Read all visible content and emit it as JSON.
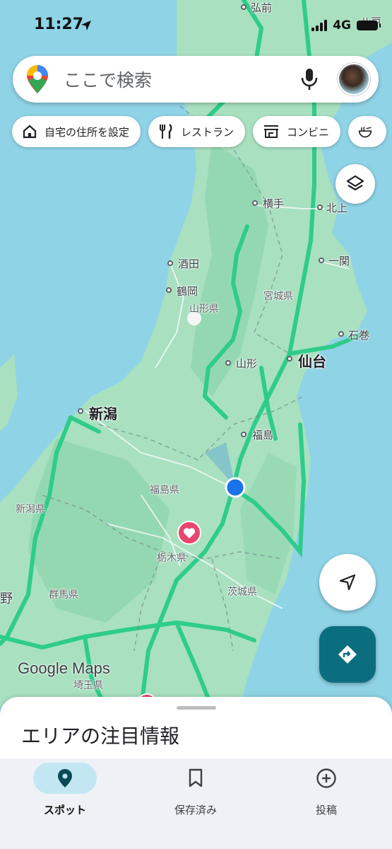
{
  "status_bar": {
    "time": "11:27",
    "network": "4G"
  },
  "search": {
    "placeholder": "ここで検索"
  },
  "chips": [
    {
      "label": "自宅の住所を設定",
      "icon": "home-icon"
    },
    {
      "label": "レストラン",
      "icon": "restaurant-icon"
    },
    {
      "label": "コンビニ",
      "icon": "store-icon"
    }
  ],
  "map": {
    "brand": "Google Maps",
    "cities": {
      "hirosaki": "弘前",
      "hachinohe": "八戸",
      "yokote": "横手",
      "kitakami": "北上",
      "ichinoseki": "一関",
      "sakata": "酒田",
      "tsuruoka": "鶴岡",
      "yamagata": "山形",
      "sendai": "仙台",
      "ishinomaki": "石巻",
      "niigata": "新潟",
      "fukushima": "福島"
    },
    "prefectures": {
      "yamagata": "山形県",
      "miyagi": "宮城県",
      "fukushima": "福島県",
      "niigata": "新潟県",
      "tochigi": "栃木県",
      "gunma": "群馬県",
      "ibaraki": "茨城県",
      "saitama": "埼玉県"
    },
    "partial": {
      "no": "野"
    }
  },
  "sheet": {
    "title": "エリアの注目情報"
  },
  "nav": [
    {
      "label": "スポット",
      "icon": "place-icon",
      "active": true
    },
    {
      "label": "保存済み",
      "icon": "bookmark-icon",
      "active": false
    },
    {
      "label": "投稿",
      "icon": "add-circle-icon",
      "active": false
    }
  ],
  "colors": {
    "land": "#a8e0c0",
    "sea": "#8fd3e6",
    "road": "#2ecc8a",
    "accent": "#0b6e7f",
    "location": "#1a73e8"
  }
}
